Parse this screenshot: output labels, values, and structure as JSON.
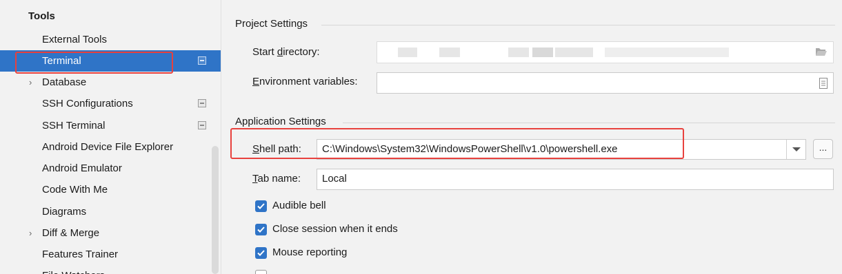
{
  "sidebar": {
    "header": "Tools",
    "items": [
      {
        "label": "External Tools",
        "arrow": "",
        "config_icon": false
      },
      {
        "label": "Terminal",
        "arrow": "",
        "config_icon": true,
        "selected": true
      },
      {
        "label": "Database",
        "arrow": "›",
        "config_icon": false
      },
      {
        "label": "SSH Configurations",
        "arrow": "",
        "config_icon": true
      },
      {
        "label": "SSH Terminal",
        "arrow": "",
        "config_icon": true
      },
      {
        "label": "Android Device File Explorer",
        "arrow": "",
        "config_icon": false
      },
      {
        "label": "Android Emulator",
        "arrow": "",
        "config_icon": false
      },
      {
        "label": "Code With Me",
        "arrow": "",
        "config_icon": false
      },
      {
        "label": "Diagrams",
        "arrow": "",
        "config_icon": false
      },
      {
        "label": "Diff & Merge",
        "arrow": "›",
        "config_icon": false
      },
      {
        "label": "Features Trainer",
        "arrow": "",
        "config_icon": false
      },
      {
        "label": "File Watchers",
        "arrow": "",
        "config_icon": false
      }
    ]
  },
  "project_settings": {
    "title": "Project Settings",
    "start_directory_label_pre": "Start ",
    "start_directory_label_mnemonic": "d",
    "start_directory_label_post": "irectory:",
    "environment_label_mnemonic": "E",
    "environment_label_post": "nvironment variables:",
    "environment_value": ""
  },
  "application_settings": {
    "title": "Application Settings",
    "shell_path_label_mnemonic": "S",
    "shell_path_label_post": "hell path:",
    "shell_path_value": "C:\\Windows\\System32\\WindowsPowerShell\\v1.0\\powershell.exe",
    "browse_label": "...",
    "tab_name_label_mnemonic": "T",
    "tab_name_label_post": "ab name:",
    "tab_name_value": "Local",
    "checkboxes": [
      {
        "label": "Audible bell",
        "checked": true
      },
      {
        "label": "Close session when it ends",
        "checked": true
      },
      {
        "label": "Mouse reporting",
        "checked": true
      },
      {
        "label": "",
        "checked": false
      }
    ]
  },
  "icons": {
    "folder": "folder-open-icon",
    "document": "document-icon",
    "dropdown": "chevron-down-icon",
    "check": "check-icon",
    "config": "project-config-icon",
    "expand": "chevron-right-icon"
  },
  "colors": {
    "selection": "#2f74c7",
    "highlight_box": "#e8413d",
    "checkbox": "#2f74c7"
  }
}
